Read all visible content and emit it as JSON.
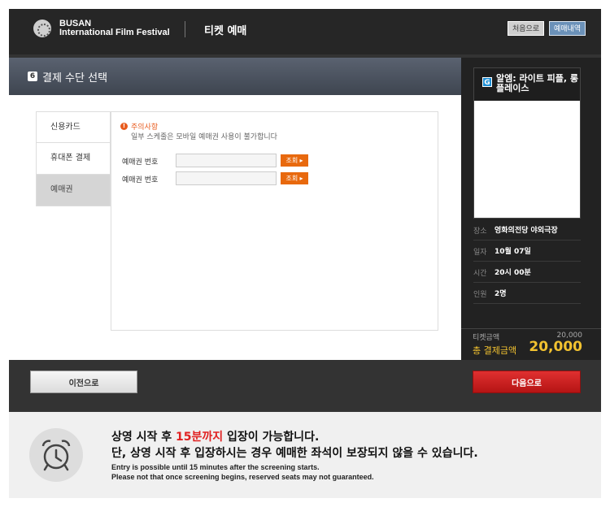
{
  "header": {
    "logo_line1": "BUSAN",
    "logo_line2": "International Film Festival",
    "title": "티켓 예매",
    "home_button": "처음으로",
    "history_button": "예매내역"
  },
  "step": {
    "number": "6",
    "title": "결제 수단 선택"
  },
  "payment_tabs": [
    {
      "label": "신용카드"
    },
    {
      "label": "휴대폰 결제"
    },
    {
      "label": "예매권"
    }
  ],
  "notice": {
    "icon": "!",
    "title": "주의사항",
    "text": "일부 스케줄은 모바일 예매권 사용이 불가합니다"
  },
  "voucher_fields": [
    {
      "label": "예매권 번호",
      "value": "",
      "button": "조회 ▸"
    },
    {
      "label": "예매권 번호",
      "value": "",
      "button": "조회 ▸"
    }
  ],
  "movie": {
    "grade": "G",
    "title": "알엠: 라이트 피플, 롱 플레이스"
  },
  "info": [
    {
      "key": "장소",
      "value": "영화의전당 야외극장"
    },
    {
      "key": "일자",
      "value": "10월 07일"
    },
    {
      "key": "시간",
      "value": "20시 00분"
    },
    {
      "key": "인원",
      "value": "2명"
    }
  ],
  "price": {
    "ticket_label": "티켓금액",
    "ticket_value": "20,000",
    "total_label": "총 결제금액",
    "total_value": "20,000"
  },
  "nav": {
    "prev": "이전으로",
    "next": "다음으로"
  },
  "footer": {
    "line1_pre": "상영 시작 후 ",
    "line1_highlight": "15분까지",
    "line1_post": " 입장이 가능합니다.",
    "line2": "단, 상영 시작 후 입장하시는 경우 예매한 좌석이 보장되지 않을 수 있습니다.",
    "en1": "Entry is possible until 15 minutes after the screening starts.",
    "en2": "Please not that once screening begins, reserved seats may not guaranteed."
  },
  "colors": {
    "accent_orange": "#e8690e",
    "next_red": "#c81e1e",
    "total_yellow": "#f2c230",
    "highlight_red": "#e02020"
  }
}
